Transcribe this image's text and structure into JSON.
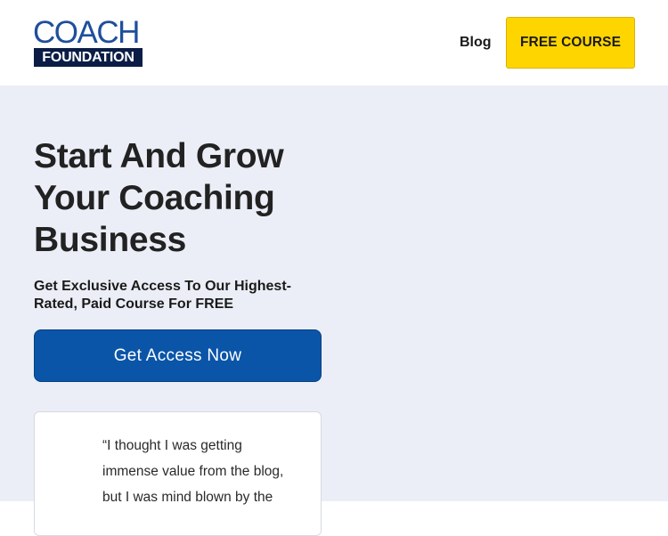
{
  "header": {
    "logo": {
      "top": "COACH",
      "bottom": "FOUNDATION"
    },
    "nav": {
      "blog_label": "Blog",
      "cta_label": "FREE COURSE"
    }
  },
  "hero": {
    "title": "Start And Grow Your Coaching Business",
    "subtitle": "Get Exclusive Access To Our Highest-Rated, Paid Course For FREE",
    "cta_label": "Get Access Now",
    "testimonial": {
      "text": "“I thought I was getting\nimmense value from the blog,\nbut I was mind blown by the"
    }
  },
  "colors": {
    "brand_blue": "#1f4f9c",
    "brand_navy": "#0b1d46",
    "cta_yellow": "#ffd500",
    "cta_blue": "#0a55a8",
    "hero_background": "#ebeef6"
  }
}
